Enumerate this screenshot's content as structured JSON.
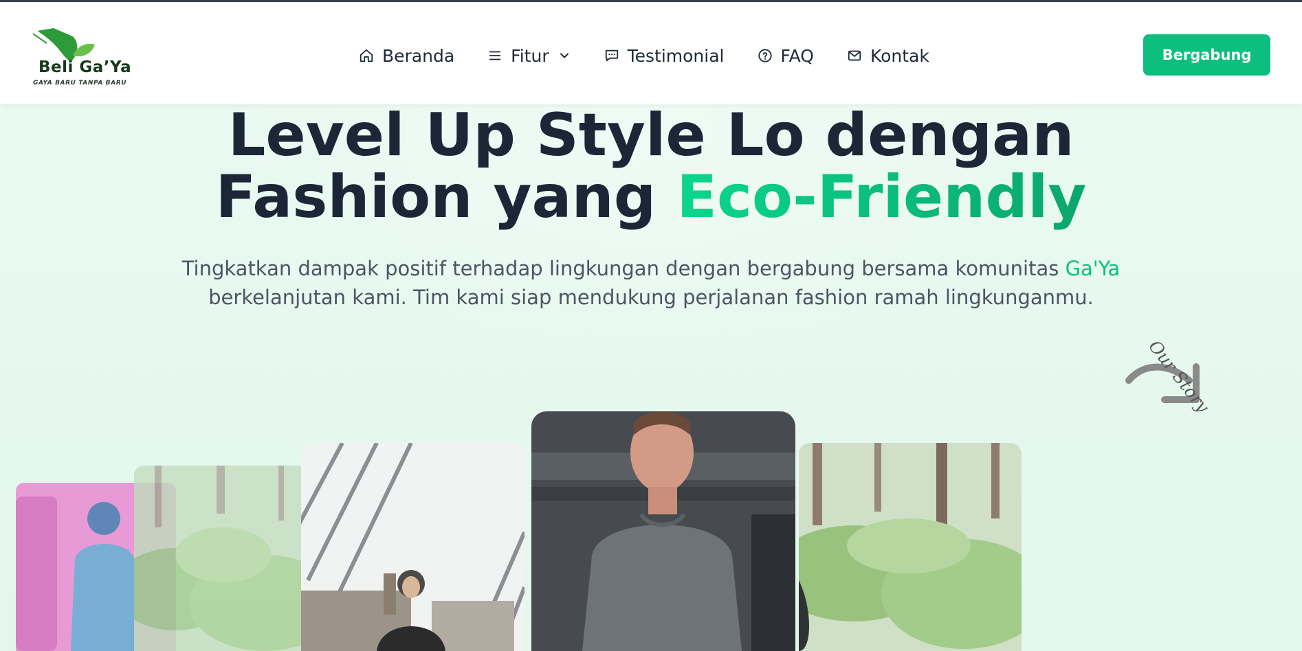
{
  "brand": {
    "name": "Beli Ga’Ya",
    "tagline": "GAYA BARU TANPA BARU",
    "leaf_colors": [
      "#2e9b3a",
      "#6cc04a"
    ]
  },
  "nav": {
    "items": [
      {
        "label": "Beranda",
        "icon": "home-icon"
      },
      {
        "label": "Fitur",
        "icon": "menu-icon",
        "dropdown": true
      },
      {
        "label": "Testimonial",
        "icon": "chat-icon"
      },
      {
        "label": "FAQ",
        "icon": "help-circle-icon"
      },
      {
        "label": "Kontak",
        "icon": "mail-icon"
      }
    ]
  },
  "cta": {
    "join_label": "Bergabung",
    "color": "#0cbf7f"
  },
  "hero": {
    "title_line1": "Level Up Style Lo dengan",
    "title_line2_plain": "Fashion yang ",
    "title_line2_accent": "Eco-Friendly",
    "subtitle_part1": "Tingkatkan dampak positif terhadap lingkungan dengan bergabung bersama komunitas ",
    "subtitle_highlight": "Ga'Ya",
    "subtitle_part2": "berkelanjutan kami. Tim kami siap mendukung perjalanan fashion ramah lingkunganmu."
  },
  "story": {
    "label": "Our Story",
    "icon": "curved-arrow-icon"
  },
  "gallery": {
    "cards": [
      {
        "subject": "man in blue shirt on pink background"
      },
      {
        "subject": "fern forest"
      },
      {
        "subject": "woman in hijab under bridge cables"
      },
      {
        "subject": "man in grey t-shirt"
      },
      {
        "subject": "forest ferns and trees"
      }
    ]
  },
  "colors": {
    "accent": "#0cbf7f",
    "heading": "#1b2637",
    "background": "#e6f8ef"
  }
}
